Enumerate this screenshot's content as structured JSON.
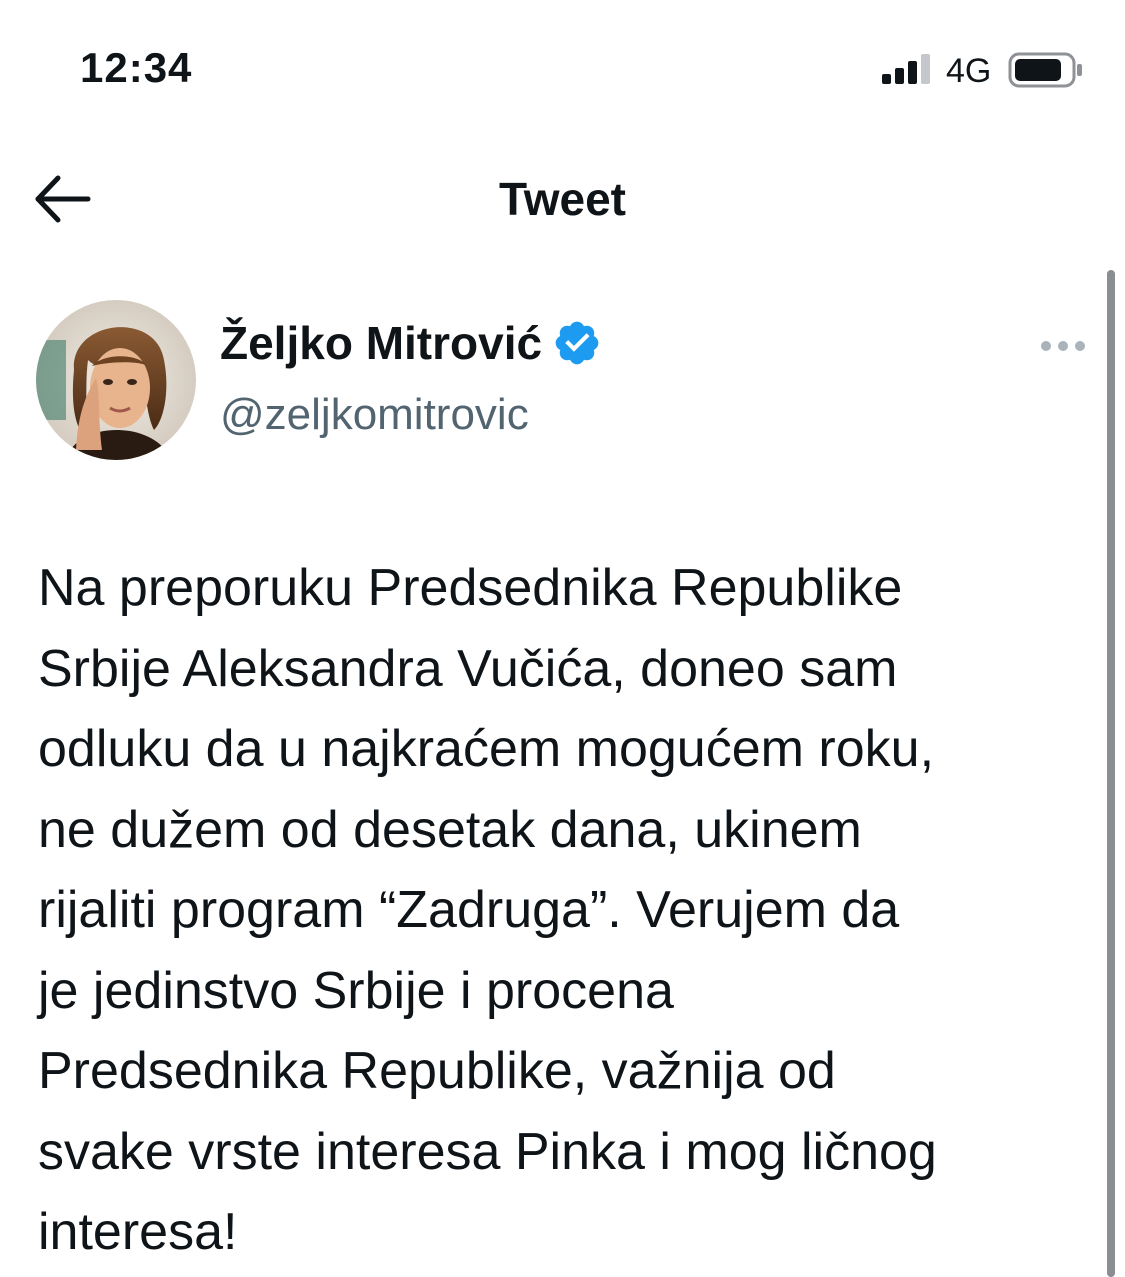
{
  "status_bar": {
    "time": "12:34",
    "network": "4G",
    "icons": [
      "signal-icon",
      "battery-icon"
    ]
  },
  "nav": {
    "title": "Tweet",
    "back_icon": "back-arrow-icon"
  },
  "tweet": {
    "author_name": "Željko Mitrović",
    "author_handle": "@zeljkomitrovic",
    "verified": true,
    "verified_color": "#1d9bf0",
    "more_icon": "more-options-icon",
    "text": "Na preporuku Predsednika Republike\nSrbije Aleksandra Vučića, doneo sam\nodluku da u najkraćem mogućem roku,\nne dužem od desetak dana, ukinem\nrijaliti program “Zadruga”. Verujem da\nje jedinstvo Srbije i procena\nPredsednika Republike, važnija od\nsvake vrste interesa Pinka i mog ličnog\ninteresa!"
  }
}
